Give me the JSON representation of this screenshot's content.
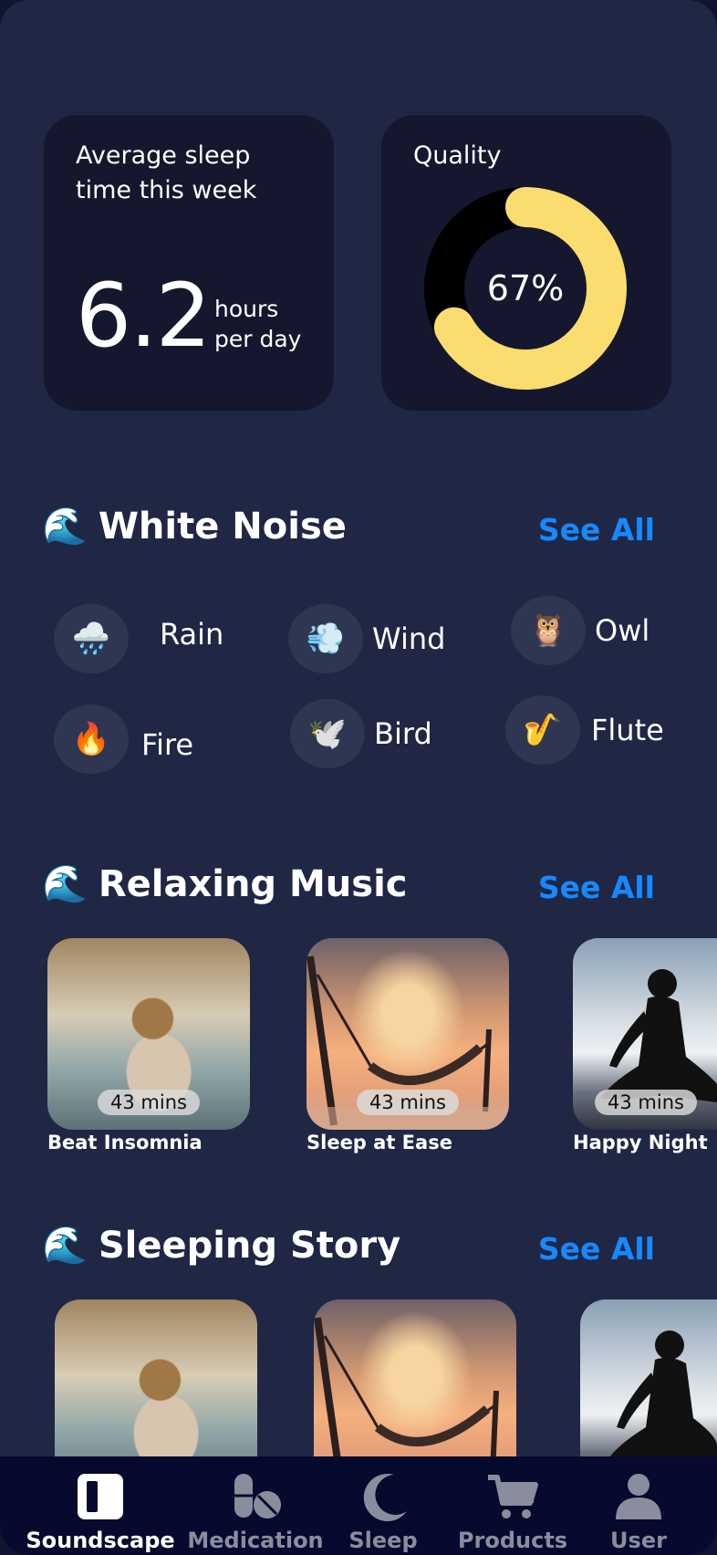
{
  "stats": {
    "average": {
      "label": "Average sleep time this week",
      "value": "6.2",
      "unit": "hours per day"
    },
    "quality": {
      "label": "Quality",
      "percent_text": "67%",
      "percent": 67,
      "color": "#fbdc6e",
      "track_color": "#000000"
    }
  },
  "white_noise": {
    "emoji": "🌊",
    "title": "White Noise",
    "see_all": "See All",
    "items": [
      {
        "label": "Rain",
        "icon": "🌧️"
      },
      {
        "label": "Wind",
        "icon": "💨"
      },
      {
        "label": "Owl",
        "icon": "🦉"
      },
      {
        "label": "Fire",
        "icon": "🔥"
      },
      {
        "label": "Bird",
        "icon": "🕊️"
      },
      {
        "label": "Flute",
        "icon": "🎷"
      }
    ]
  },
  "relaxing_music": {
    "emoji": "🌊",
    "title": "Relaxing Music",
    "see_all": "See All",
    "items": [
      {
        "title": "Beat Insomnia",
        "duration": "43 mins",
        "image": "spa"
      },
      {
        "title": "Sleep at Ease",
        "duration": "43 mins",
        "image": "hammock"
      },
      {
        "title": "Happy Night",
        "duration": "43 mins",
        "image": "yoga"
      }
    ]
  },
  "sleeping_story": {
    "emoji": "🌊",
    "title": "Sleeping Story",
    "see_all": "See All",
    "items": [
      {
        "image": "spa"
      },
      {
        "image": "hammock"
      },
      {
        "image": "yoga"
      }
    ]
  },
  "tabbar": {
    "tabs": [
      {
        "label": "Soundscape",
        "icon": "soundscape-icon",
        "active": true
      },
      {
        "label": "Medication",
        "icon": "pills-icon",
        "active": false
      },
      {
        "label": "Sleep",
        "icon": "moon-icon",
        "active": false
      },
      {
        "label": "Products",
        "icon": "cart-icon",
        "active": false
      },
      {
        "label": "User",
        "icon": "user-icon",
        "active": false
      }
    ]
  },
  "colors": {
    "background": "#1f2745",
    "card": "#15172e",
    "accent": "#1689ff",
    "tabbar": "#050a2e"
  }
}
